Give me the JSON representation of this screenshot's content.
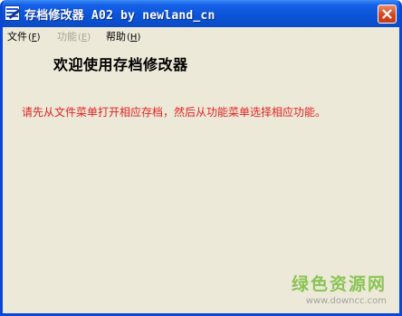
{
  "window": {
    "title": "存档修改器 A02 by newland_cn",
    "icon": "app-icon",
    "close_icon": "close-icon"
  },
  "menu": {
    "items": [
      {
        "label": "文件",
        "mnemonic": "F",
        "enabled": true
      },
      {
        "label": "功能",
        "mnemonic": "E",
        "enabled": false
      },
      {
        "label": "帮助",
        "mnemonic": "H",
        "enabled": true
      }
    ]
  },
  "content": {
    "heading": "欢迎使用存档修改器",
    "instruction": "请先从文件菜单打开相应存档，然后从功能菜单选择相应功能。"
  },
  "watermark": {
    "text": "绿色资源网",
    "url": "www.downcc.com"
  },
  "colors": {
    "title_bar": "#0a55d8",
    "window_bg": "#ece9d8",
    "instruction_text": "#e32222",
    "disabled_menu": "#a7a497"
  }
}
